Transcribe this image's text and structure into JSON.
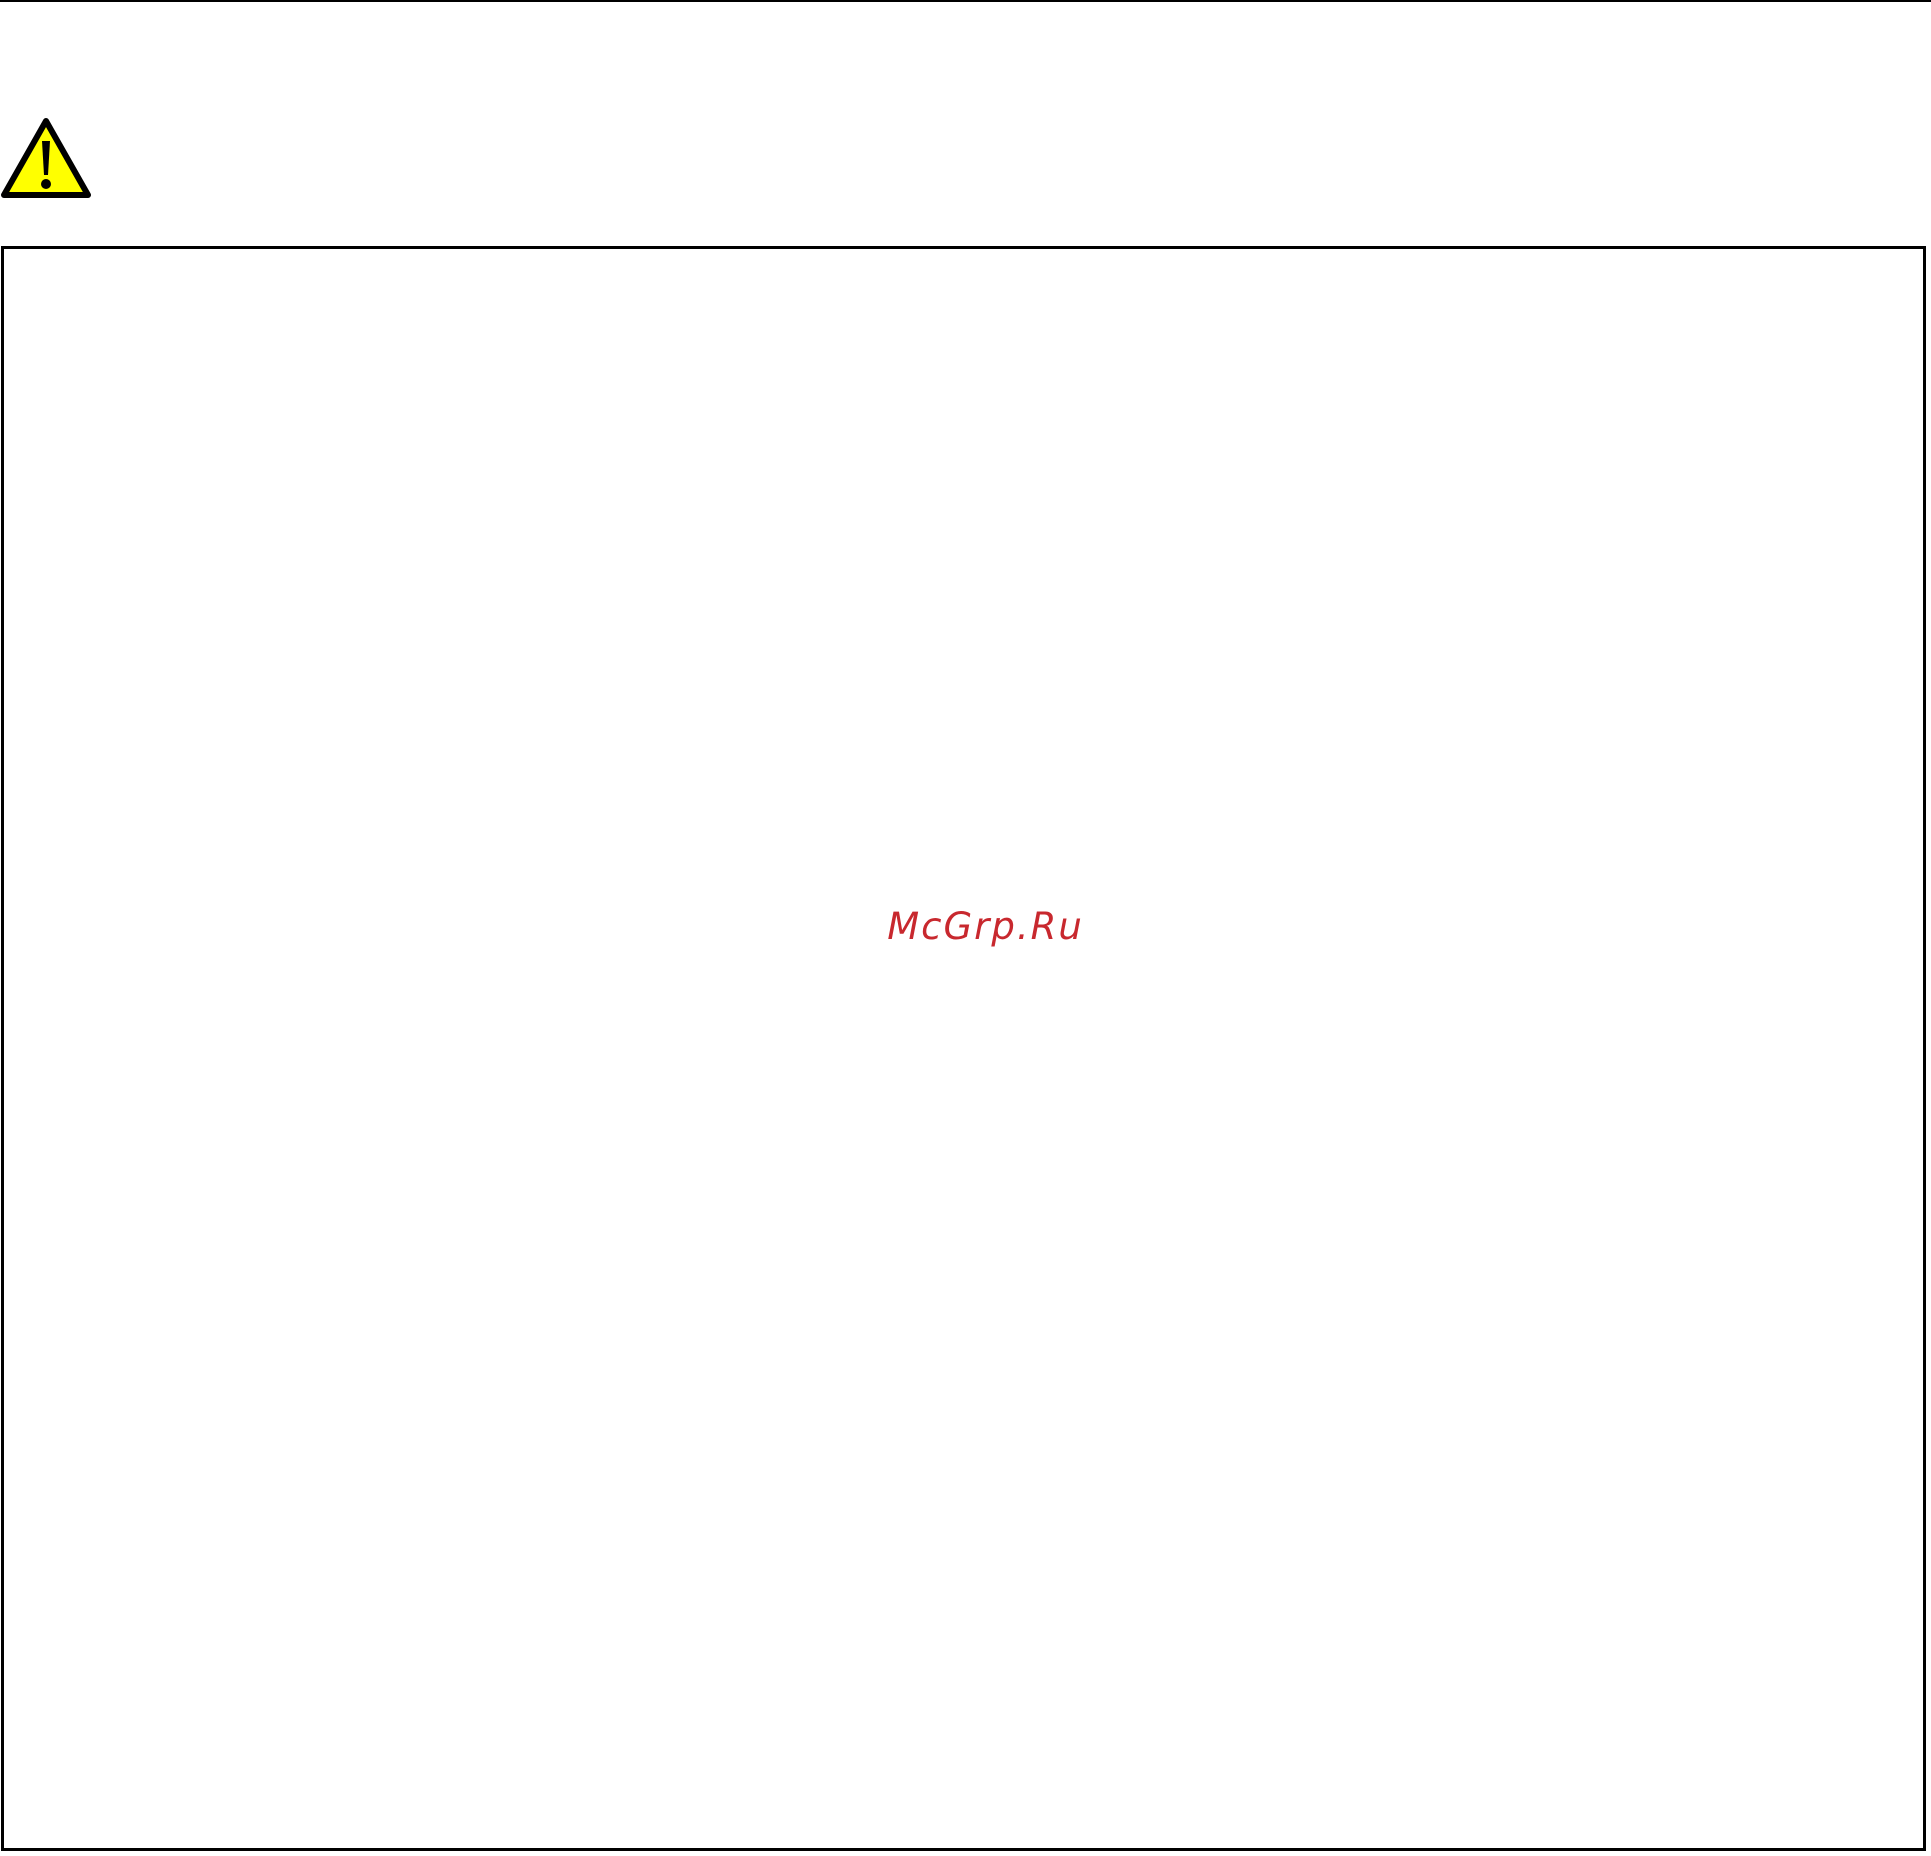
{
  "watermark": {
    "text": "McGrp.Ru",
    "color": "#c8282e"
  },
  "warning": {
    "icon": "warning-triangle-icon",
    "fill_color": "#ffff00",
    "stroke_color": "#000000"
  },
  "frame": {
    "border_color": "#000000"
  }
}
